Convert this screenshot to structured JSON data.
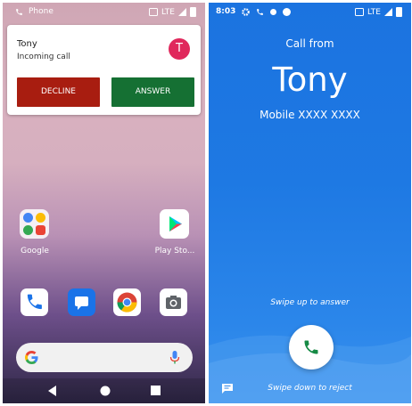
{
  "left_screen": {
    "status": {
      "app": "Phone",
      "network": "LTE"
    },
    "notification": {
      "caller": "Tony",
      "subtitle": "Incoming call",
      "avatar_letter": "T",
      "decline_label": "DECLINE",
      "answer_label": "ANSWER"
    },
    "home": {
      "folder_label": "Google",
      "play_label": "Play Sto..."
    }
  },
  "right_screen": {
    "status": {
      "time": "8:03",
      "network": "LTE"
    },
    "call_from_label": "Call from",
    "caller_name": "Tony",
    "caller_number": "Mobile XXXX XXXX",
    "swipe_up_hint": "Swipe up to answer",
    "swipe_down_hint": "Swipe down to reject"
  },
  "colors": {
    "decline": "#a81d10",
    "answer": "#157033",
    "avatar": "#e0285c",
    "call_bg": "#1b73e0",
    "answer_icon": "#168a45"
  }
}
